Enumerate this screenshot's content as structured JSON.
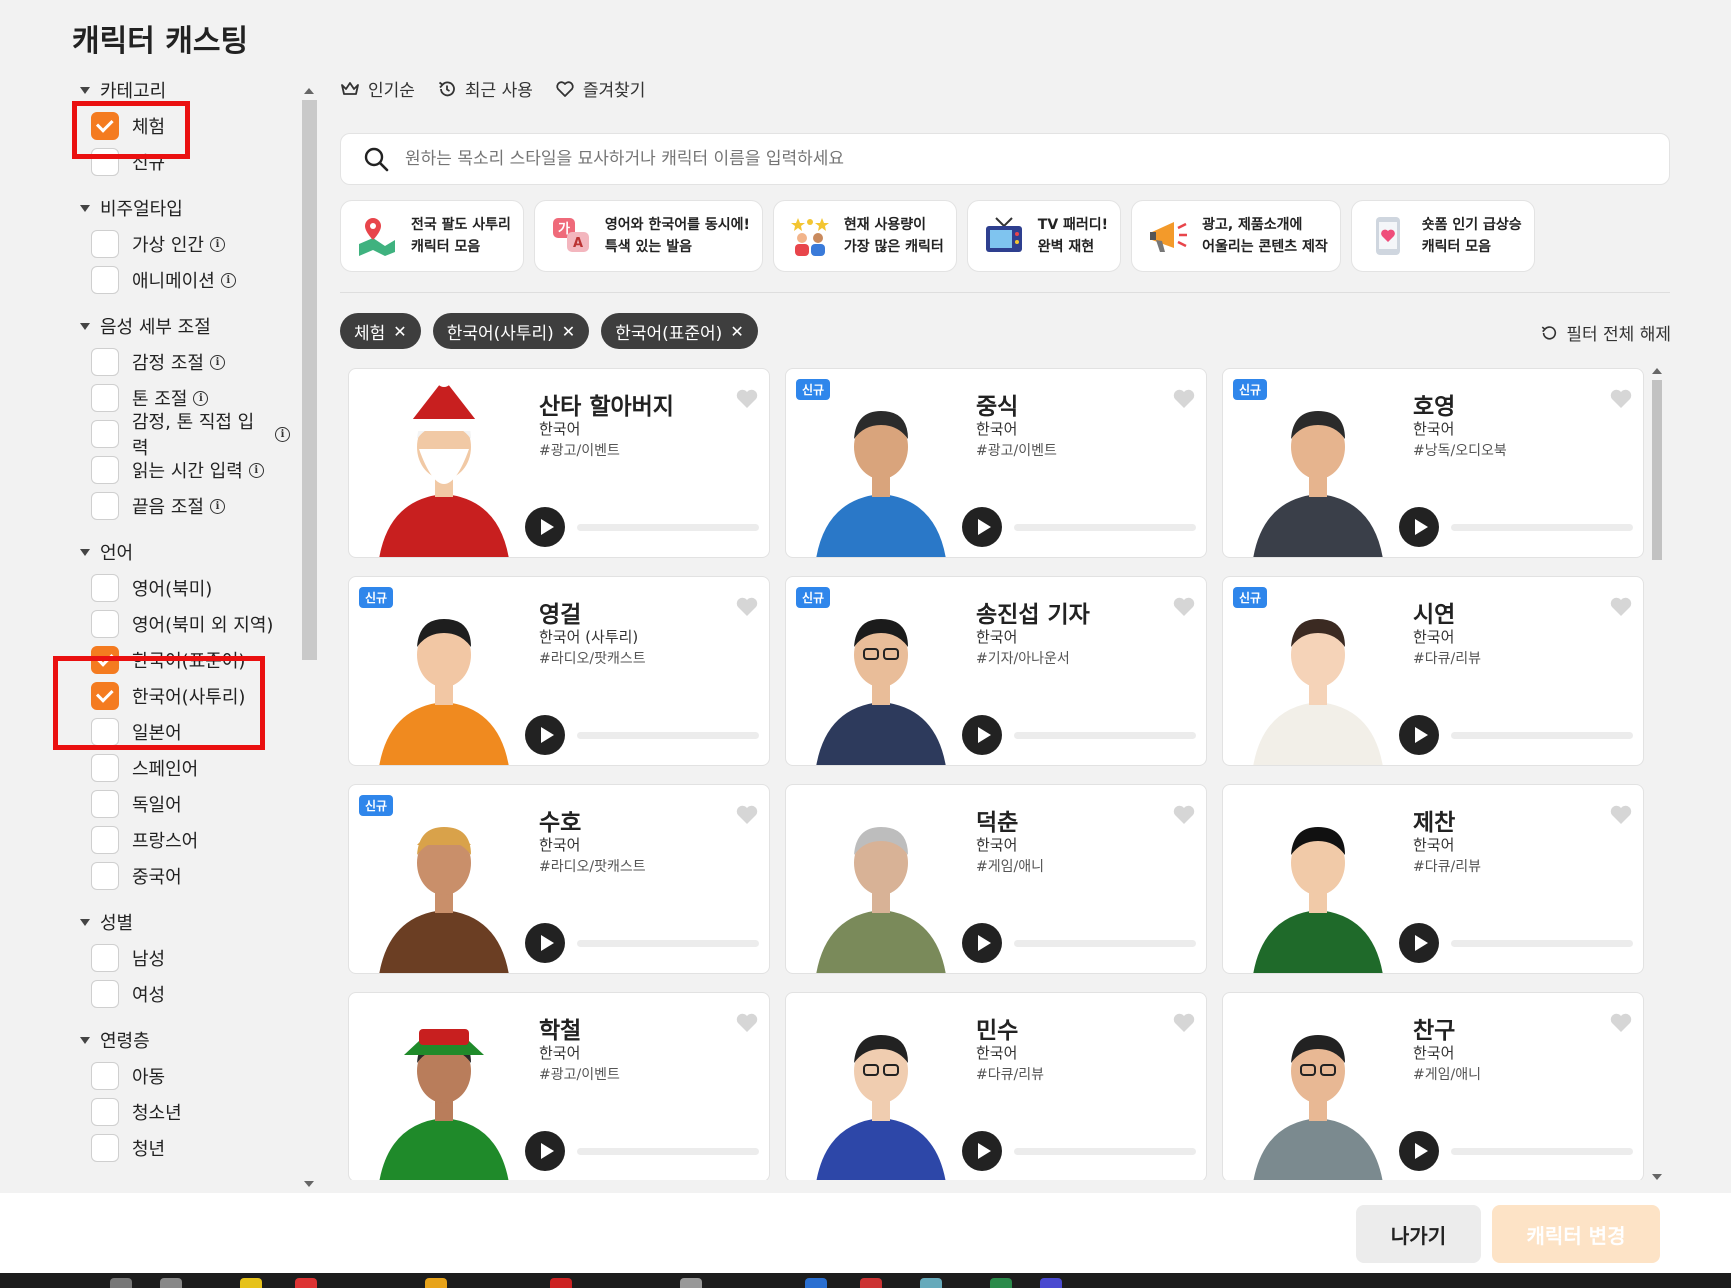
{
  "page_title": "캐릭터 캐스팅",
  "sidebar": {
    "sections": [
      {
        "label": "카테고리",
        "options": [
          {
            "label": "체험",
            "checked": true
          },
          {
            "label": "신규",
            "checked": false
          }
        ]
      },
      {
        "label": "비주얼타입",
        "options": [
          {
            "label": "가상 인간",
            "checked": false,
            "info": true
          },
          {
            "label": "애니메이션",
            "checked": false,
            "info": true
          }
        ]
      },
      {
        "label": "음성 세부 조절",
        "options": [
          {
            "label": "감정 조절",
            "checked": false,
            "info": true
          },
          {
            "label": "톤 조절",
            "checked": false,
            "info": true
          },
          {
            "label": "감정, 톤 직접 입력",
            "checked": false,
            "info": true
          },
          {
            "label": "읽는 시간 입력",
            "checked": false,
            "info": true
          },
          {
            "label": "끝음 조절",
            "checked": false,
            "info": true
          }
        ]
      },
      {
        "label": "언어",
        "options": [
          {
            "label": "영어(북미)",
            "checked": false
          },
          {
            "label": "영어(북미 외 지역)",
            "checked": false
          },
          {
            "label": "한국어(표준어)",
            "checked": true
          },
          {
            "label": "한국어(사투리)",
            "checked": true
          },
          {
            "label": "일본어",
            "checked": false
          },
          {
            "label": "스페인어",
            "checked": false
          },
          {
            "label": "독일어",
            "checked": false
          },
          {
            "label": "프랑스어",
            "checked": false
          },
          {
            "label": "중국어",
            "checked": false
          }
        ]
      },
      {
        "label": "성별",
        "options": [
          {
            "label": "남성",
            "checked": false
          },
          {
            "label": "여성",
            "checked": false
          }
        ]
      },
      {
        "label": "연령층",
        "options": [
          {
            "label": "아동",
            "checked": false
          },
          {
            "label": "청소년",
            "checked": false
          },
          {
            "label": "청년",
            "checked": false
          }
        ]
      }
    ]
  },
  "sort": {
    "popular": "인기순",
    "recent": "최근 사용",
    "favorites": "즐겨찾기"
  },
  "search": {
    "placeholder": "원하는 목소리 스타일을 묘사하거나 캐릭터 이름을 입력하세요"
  },
  "themes": [
    {
      "line1": "전국 팔도 사투리",
      "line2": "캐릭터 모음",
      "icon": "map-pin-icon"
    },
    {
      "line1": "영어와 한국어를 동시에!",
      "line2": "특색 있는 발음",
      "icon": "translate-icon"
    },
    {
      "line1": "현재 사용량이",
      "line2": "가장 많은 캐릭터",
      "icon": "people-stars-icon"
    },
    {
      "line1": "TV 패러디!",
      "line2": "완벽 재현",
      "icon": "tv-icon"
    },
    {
      "line1": "광고, 제품소개에",
      "line2": "어울리는 콘텐츠 제작",
      "icon": "megaphone-icon"
    },
    {
      "line1": "숏폼 인기 급상승",
      "line2": "캐릭터 모음",
      "icon": "phone-heart-icon"
    }
  ],
  "filter_chips": [
    "체험",
    "한국어(사투리)",
    "한국어(표준어)"
  ],
  "reset_label": "필터 전체 해제",
  "new_badge": "신규",
  "characters": [
    {
      "name": "산타 할아버지",
      "lang": "한국어",
      "tag": "#광고/이벤트",
      "new": false
    },
    {
      "name": "중식",
      "lang": "한국어",
      "tag": "#광고/이벤트",
      "new": true
    },
    {
      "name": "호영",
      "lang": "한국어",
      "tag": "#낭독/오디오북",
      "new": true
    },
    {
      "name": "영걸",
      "lang": "한국어 (사투리)",
      "tag": "#라디오/팟캐스트",
      "new": true
    },
    {
      "name": "송진섭 기자",
      "lang": "한국어",
      "tag": "#기자/아나운서",
      "new": true
    },
    {
      "name": "시연",
      "lang": "한국어",
      "tag": "#다큐/리뷰",
      "new": true
    },
    {
      "name": "수호",
      "lang": "한국어",
      "tag": "#라디오/팟캐스트",
      "new": true
    },
    {
      "name": "덕춘",
      "lang": "한국어",
      "tag": "#게임/애니",
      "new": false
    },
    {
      "name": "제찬",
      "lang": "한국어",
      "tag": "#다큐/리뷰",
      "new": false
    },
    {
      "name": "학철",
      "lang": "한국어",
      "tag": "#광고/이벤트",
      "new": false
    },
    {
      "name": "민수",
      "lang": "한국어",
      "tag": "#다큐/리뷰",
      "new": false
    },
    {
      "name": "찬구",
      "lang": "한국어",
      "tag": "#게임/애니",
      "new": false
    }
  ],
  "footer": {
    "exit_label": "나가기",
    "change_label": "캐릭터 변경"
  },
  "colors": {
    "accent": "#f47b20",
    "chip_bg": "#3e3e3e",
    "badge": "#2f86eb",
    "highlight": "#ea1010"
  }
}
